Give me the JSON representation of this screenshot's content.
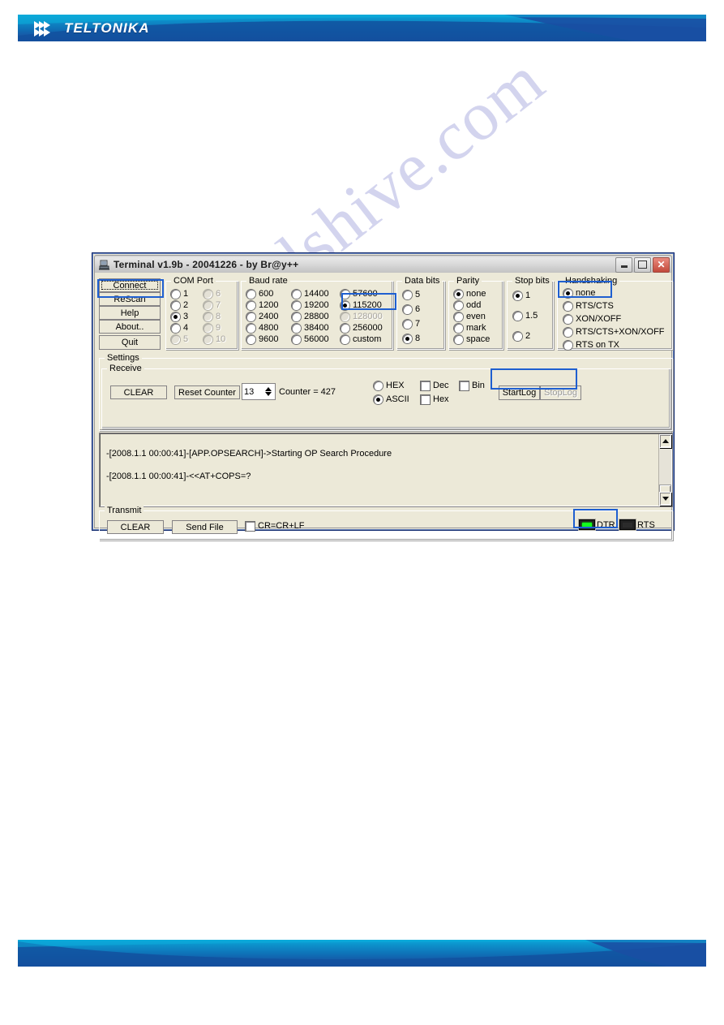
{
  "page": {
    "watermark": "manualshive.com",
    "brand": {
      "name": "TELTONIKA",
      "logo_icon": "teltonika-chevrons-icon",
      "banner_color": "#0f6cb4"
    }
  },
  "window": {
    "title": "Terminal v1.9b - 20041226 - by Br@y++",
    "icon": "terminal-app-icon",
    "controls": {
      "minimize": "_",
      "maximize": "□",
      "close": "✕"
    },
    "accent_highlight": "#1f5fd0"
  },
  "actions": {
    "connect": "Connect",
    "rescan": "ReScan",
    "help": "Help",
    "about": "About..",
    "quit": "Quit"
  },
  "com_port": {
    "legend": "COM Port",
    "selected": "3",
    "col1": [
      {
        "label": "1",
        "checked": false,
        "disabled": false
      },
      {
        "label": "2",
        "checked": false,
        "disabled": false
      },
      {
        "label": "3",
        "checked": true,
        "disabled": false
      },
      {
        "label": "4",
        "checked": false,
        "disabled": false
      },
      {
        "label": "5",
        "checked": false,
        "disabled": true
      }
    ],
    "col2": [
      {
        "label": "6",
        "checked": false,
        "disabled": true
      },
      {
        "label": "7",
        "checked": false,
        "disabled": true
      },
      {
        "label": "8",
        "checked": false,
        "disabled": true
      },
      {
        "label": "9",
        "checked": false,
        "disabled": true
      },
      {
        "label": "10",
        "checked": false,
        "disabled": true
      }
    ]
  },
  "baud_rate": {
    "legend": "Baud rate",
    "selected": "115200",
    "col1": [
      {
        "label": "600",
        "checked": false
      },
      {
        "label": "1200",
        "checked": false
      },
      {
        "label": "2400",
        "checked": false
      },
      {
        "label": "4800",
        "checked": false
      },
      {
        "label": "9600",
        "checked": false
      }
    ],
    "col2": [
      {
        "label": "14400",
        "checked": false
      },
      {
        "label": "19200",
        "checked": false
      },
      {
        "label": "28800",
        "checked": false
      },
      {
        "label": "38400",
        "checked": false
      },
      {
        "label": "56000",
        "checked": false
      }
    ],
    "col3": [
      {
        "label": "57600",
        "checked": false
      },
      {
        "label": "115200",
        "checked": true
      },
      {
        "label": "128000",
        "checked": false
      },
      {
        "label": "256000",
        "checked": false
      },
      {
        "label": "custom",
        "checked": false
      }
    ]
  },
  "data_bits": {
    "legend": "Data bits",
    "selected": "8",
    "options": [
      {
        "label": "5",
        "checked": false
      },
      {
        "label": "6",
        "checked": false
      },
      {
        "label": "7",
        "checked": false
      },
      {
        "label": "8",
        "checked": true
      }
    ]
  },
  "parity": {
    "legend": "Parity",
    "selected": "none",
    "options": [
      {
        "label": "none",
        "checked": true
      },
      {
        "label": "odd",
        "checked": false
      },
      {
        "label": "even",
        "checked": false
      },
      {
        "label": "mark",
        "checked": false
      },
      {
        "label": "space",
        "checked": false
      }
    ]
  },
  "stop_bits": {
    "legend": "Stop bits",
    "selected": "1",
    "options": [
      {
        "label": "1",
        "checked": true
      },
      {
        "label": "1.5",
        "checked": false
      },
      {
        "label": "2",
        "checked": false
      }
    ]
  },
  "handshaking": {
    "legend": "Handshaking",
    "selected": "none",
    "options": [
      {
        "label": "none",
        "checked": true
      },
      {
        "label": "RTS/CTS",
        "checked": false
      },
      {
        "label": "XON/XOFF",
        "checked": false
      },
      {
        "label": "RTS/CTS+XON/XOFF",
        "checked": false
      },
      {
        "label": "RTS on TX",
        "checked": false
      }
    ]
  },
  "settings": {
    "legend": "Settings"
  },
  "receive": {
    "legend": "Receive",
    "clear": "CLEAR",
    "reset_counter": "Reset Counter",
    "spin_value": "13",
    "counter_text": "Counter =  427",
    "format": {
      "hex": {
        "label": "HEX",
        "checked": false
      },
      "ascii": {
        "label": "ASCII",
        "checked": true
      }
    },
    "checks": [
      {
        "label": "Dec",
        "checked": false
      },
      {
        "label": "Hex",
        "checked": false
      },
      {
        "label": "Bin",
        "checked": false
      }
    ],
    "start_log": "StartLog",
    "stop_log": "StopLog",
    "stop_log_disabled": true
  },
  "terminal": {
    "lines": [
      "-[2008.1.1 00:00:41]-[APP.OPSEARCH]->Starting OP Search Procedure",
      "-[2008.1.1 00:00:41]-<<AT+COPS=?"
    ],
    "scrollbar": {
      "up": "▲",
      "down": "▼"
    }
  },
  "transmit": {
    "legend": "Transmit",
    "clear": "CLEAR",
    "send_file": "Send File",
    "cr_lf": {
      "label": "CR=CR+LF",
      "checked": false
    },
    "dtr": {
      "label": "DTR",
      "on": true
    },
    "rts": {
      "label": "RTS",
      "on": false
    }
  }
}
